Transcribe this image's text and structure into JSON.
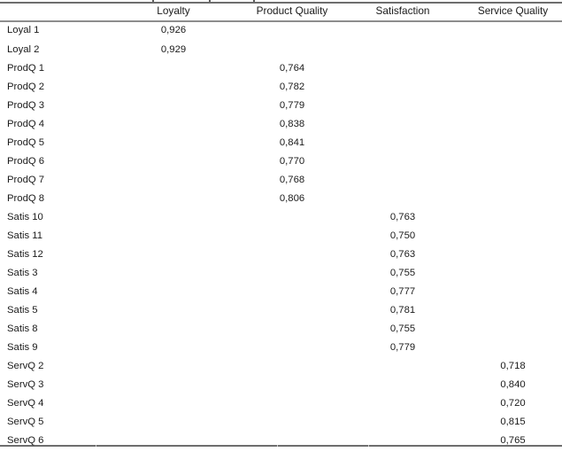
{
  "table": {
    "columns": [
      {
        "key": "label",
        "label": ""
      },
      {
        "key": "loyalty",
        "label": "Loyalty"
      },
      {
        "key": "product",
        "label": "Product Quality"
      },
      {
        "key": "satis",
        "label": "Satisfaction"
      },
      {
        "key": "service",
        "label": "Service Quality"
      }
    ],
    "rows": [
      {
        "label": "Loyal 1",
        "loyalty": "0,926",
        "product": "",
        "satis": "",
        "service": ""
      },
      {
        "label": "Loyal 2",
        "loyalty": "0,929",
        "product": "",
        "satis": "",
        "service": ""
      },
      {
        "label": "ProdQ 1",
        "loyalty": "",
        "product": "0,764",
        "satis": "",
        "service": ""
      },
      {
        "label": "ProdQ 2",
        "loyalty": "",
        "product": "0,782",
        "satis": "",
        "service": ""
      },
      {
        "label": "ProdQ 3",
        "loyalty": "",
        "product": "0,779",
        "satis": "",
        "service": ""
      },
      {
        "label": "ProdQ 4",
        "loyalty": "",
        "product": "0,838",
        "satis": "",
        "service": ""
      },
      {
        "label": "ProdQ 5",
        "loyalty": "",
        "product": "0,841",
        "satis": "",
        "service": ""
      },
      {
        "label": "ProdQ 6",
        "loyalty": "",
        "product": "0,770",
        "satis": "",
        "service": ""
      },
      {
        "label": "ProdQ 7",
        "loyalty": "",
        "product": "0,768",
        "satis": "",
        "service": ""
      },
      {
        "label": "ProdQ 8",
        "loyalty": "",
        "product": "0,806",
        "satis": "",
        "service": ""
      },
      {
        "label": "Satis 10",
        "loyalty": "",
        "product": "",
        "satis": "0,763",
        "service": ""
      },
      {
        "label": "Satis 11",
        "loyalty": "",
        "product": "",
        "satis": "0,750",
        "service": ""
      },
      {
        "label": "Satis 12",
        "loyalty": "",
        "product": "",
        "satis": "0,763",
        "service": ""
      },
      {
        "label": "Satis 3",
        "loyalty": "",
        "product": "",
        "satis": "0,755",
        "service": ""
      },
      {
        "label": "Satis 4",
        "loyalty": "",
        "product": "",
        "satis": "0,777",
        "service": ""
      },
      {
        "label": "Satis 5",
        "loyalty": "",
        "product": "",
        "satis": "0,781",
        "service": ""
      },
      {
        "label": "Satis 8",
        "loyalty": "",
        "product": "",
        "satis": "0,755",
        "service": ""
      },
      {
        "label": "Satis 9",
        "loyalty": "",
        "product": "",
        "satis": "0,779",
        "service": ""
      },
      {
        "label": "ServQ 2",
        "loyalty": "",
        "product": "",
        "satis": "",
        "service": "0,718"
      },
      {
        "label": "ServQ 3",
        "loyalty": "",
        "product": "",
        "satis": "",
        "service": "0,840"
      },
      {
        "label": "ServQ 4",
        "loyalty": "",
        "product": "",
        "satis": "",
        "service": "0,720"
      },
      {
        "label": "ServQ 5",
        "loyalty": "",
        "product": "",
        "satis": "",
        "service": "0,815"
      },
      {
        "label": "ServQ 6",
        "loyalty": "",
        "product": "",
        "satis": "",
        "service": "0,765"
      }
    ]
  },
  "style": {
    "rule_color": "#6e6e6e",
    "header_rule_color": "#8d8d8d",
    "text_color": "#1a1a1a",
    "background": "#ffffff"
  }
}
